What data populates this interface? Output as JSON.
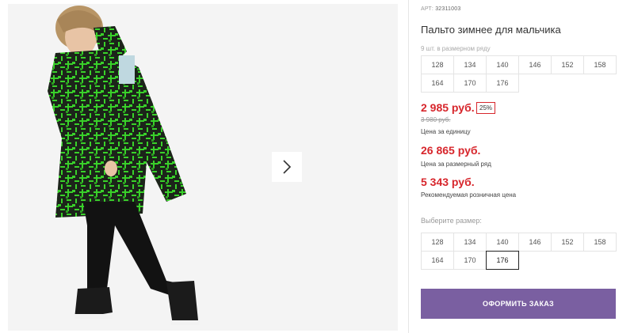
{
  "product": {
    "article_label": "АРТ:",
    "article_value": "32311003",
    "title": "Пальто зимнее для мальчика",
    "pack_note": "9 шт. в размерном ряду"
  },
  "size_row_sizes": [
    "128",
    "134",
    "140",
    "146",
    "152",
    "158",
    "164",
    "170",
    "176"
  ],
  "prices": {
    "unit_price": "2 985 руб.",
    "discount": "25%",
    "old_price": "3 980 руб.",
    "unit_caption": "Цена за единицу",
    "row_price": "26 865 руб.",
    "row_caption": "Цена за размерный ряд",
    "retail_price": "5 343 руб.",
    "retail_caption": "Рекомендуемая розничная цена"
  },
  "choose_size": {
    "label": "Выберите размер:",
    "sizes": [
      "128",
      "134",
      "140",
      "146",
      "152",
      "158",
      "164",
      "170",
      "176"
    ],
    "selected": "176"
  },
  "order_button": "ОФОРМИТЬ ЗАКАЗ",
  "colors": {
    "price_red": "#d7262c",
    "order_button": "#7a5fa1",
    "jacket_green": "#39d12a"
  },
  "icons": {
    "next_arrow": "chevron-right-icon"
  }
}
